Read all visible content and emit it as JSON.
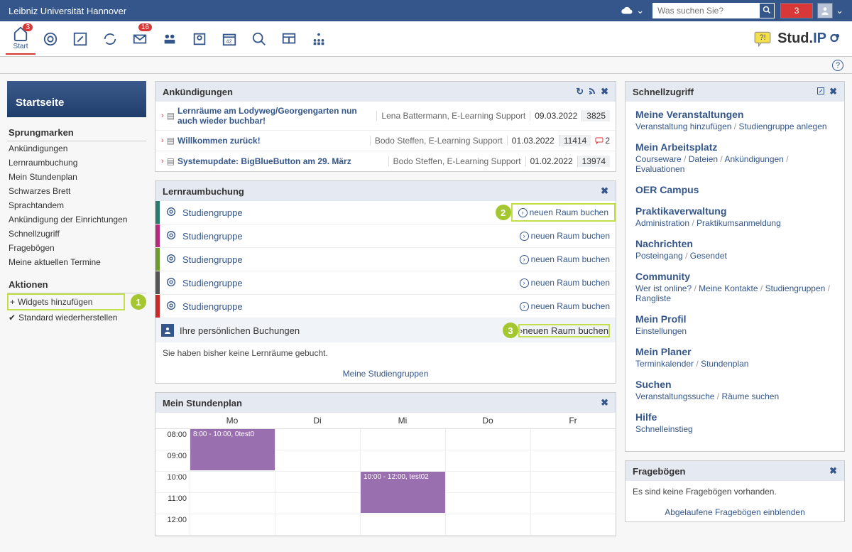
{
  "topbar": {
    "uni": "Leibniz Universität Hannover",
    "search_placeholder": "Was suchen Sie?",
    "notif_count": "3"
  },
  "nav": {
    "start_label": "Start",
    "start_badge": "3",
    "mail_badge": "16",
    "logo1": "Stud.",
    "logo2": "IP"
  },
  "left": {
    "card_title": "Startseite",
    "jumps_h": "Sprungmarken",
    "jumps": [
      "Ankündigungen",
      "Lernraumbuchung",
      "Mein Stundenplan",
      "Schwarzes Brett",
      "Sprachtandem",
      "Ankündigung der Einrichtungen",
      "Schnellzugriff",
      "Fragebögen",
      "Meine aktuellen Termine"
    ],
    "actions_h": "Aktionen",
    "action_add": "Widgets hinzufügen",
    "action_reset": "Standard wiederherstellen"
  },
  "ann": {
    "head": "Ankündigungen",
    "rows": [
      {
        "title": "Lernräume am Lodyweg/Georgengarten nun auch wieder buchbar!",
        "author": "Lena Battermann, E-Learning Support",
        "date": "09.03.2022",
        "count": "3825",
        "comments": ""
      },
      {
        "title": "Willkommen zurück!",
        "author": "Bodo Steffen, E-Learning Support",
        "date": "01.03.2022",
        "count": "11414",
        "comments": "2"
      },
      {
        "title": "Systemupdate: BigBlueButton am 29. März",
        "author": "Bodo Steffen, E-Learning Support",
        "date": "01.02.2022",
        "count": "13974",
        "comments": ""
      }
    ]
  },
  "book": {
    "head": "Lernraumbuchung",
    "group": "Studiengruppe",
    "btn": "neuen Raum buchen",
    "pers_head": "Ihre persönlichen Buchungen",
    "none": "Sie haben bisher keine Lernräume gebucht.",
    "foot": "Meine Studiengruppen"
  },
  "sched": {
    "head": "Mein Stundenplan",
    "days": [
      "Mo",
      "Di",
      "Mi",
      "Do",
      "Fr"
    ],
    "hours": [
      "08:00",
      "09:00",
      "10:00",
      "11:00",
      "12:00"
    ],
    "ev1": "8:00 - 10:00, 0test0",
    "ev2": "10:00 - 12:00, test02"
  },
  "qa": {
    "head": "Schnellzugriff",
    "secs": [
      {
        "t": "Meine Veranstaltungen",
        "s": [
          "Veranstaltung hinzufügen",
          "Studiengruppe anlegen"
        ]
      },
      {
        "t": "Mein Arbeitsplatz",
        "s": [
          "Courseware",
          "Dateien",
          "Ankündigungen",
          "Evaluationen"
        ]
      },
      {
        "t": "OER Campus",
        "s": []
      },
      {
        "t": "Praktikaverwaltung",
        "s": [
          "Administration",
          "Praktikumsanmeldung"
        ]
      },
      {
        "t": "Nachrichten",
        "s": [
          "Posteingang",
          "Gesendet"
        ]
      },
      {
        "t": "Community",
        "s": [
          "Wer ist online?",
          "Meine Kontakte",
          "Studiengruppen",
          "Rangliste"
        ]
      },
      {
        "t": "Mein Profil",
        "s": [
          "Einstellungen"
        ]
      },
      {
        "t": "Mein Planer",
        "s": [
          "Terminkalender",
          "Stundenplan"
        ]
      },
      {
        "t": "Suchen",
        "s": [
          "Veranstaltungssuche",
          "Räume suchen"
        ]
      },
      {
        "t": "Hilfe",
        "s": [
          "Schnelleinstieg"
        ]
      }
    ]
  },
  "fb": {
    "head": "Fragebögen",
    "none": "Es sind keine Fragebögen vorhanden.",
    "foot": "Abgelaufene Fragebögen einblenden"
  },
  "balls": {
    "b1": "1",
    "b2": "2",
    "b3": "3"
  }
}
